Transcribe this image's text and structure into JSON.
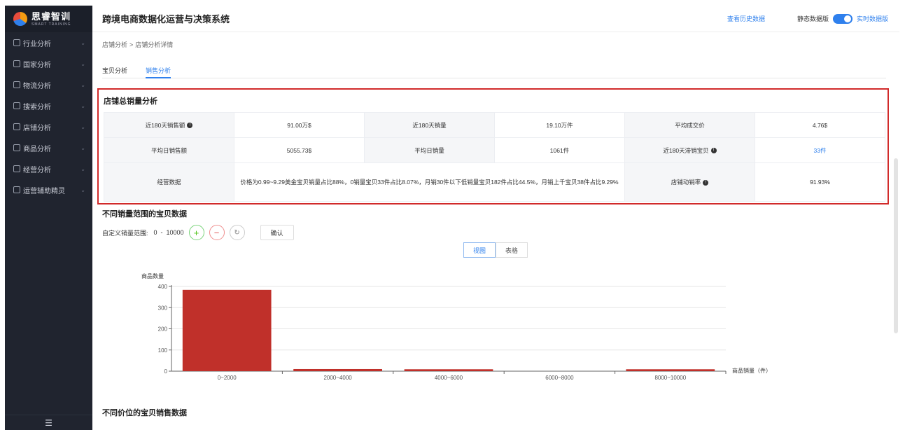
{
  "brand": {
    "name": "思睿智训",
    "sub": "SMART TRAINING"
  },
  "sidebar": {
    "items": [
      {
        "label": "行业分析"
      },
      {
        "label": "国家分析"
      },
      {
        "label": "物流分析"
      },
      {
        "label": "搜索分析"
      },
      {
        "label": "店铺分析"
      },
      {
        "label": "商品分析"
      },
      {
        "label": "经营分析"
      },
      {
        "label": "运营辅助精灵"
      }
    ],
    "chevron": "⌄",
    "footer_icon": "☰"
  },
  "header": {
    "title": "跨境电商数据化运营与决策系统",
    "history_link": "查看历史数据",
    "static_label": "静态数据版",
    "live_label": "实时数据版"
  },
  "breadcrumb": {
    "parent": "店铺分析",
    "separator": ">",
    "current": "店铺分析详情"
  },
  "tabs": [
    {
      "label": "宝贝分析"
    },
    {
      "label": "销售分析"
    }
  ],
  "summary": {
    "title": "店铺总销量分析",
    "rows": [
      [
        {
          "k": "近180天销售额",
          "v": "91.00万$"
        },
        {
          "k": "近180天销量",
          "v": "19.10万件"
        },
        {
          "k": "平均成交价",
          "v": "4.76$"
        }
      ],
      [
        {
          "k": "平均日销售额",
          "v": "5055.73$"
        },
        {
          "k": "平均日销量",
          "v": "1061件"
        },
        {
          "k": "近180天滞销宝贝",
          "v": "33件"
        }
      ]
    ],
    "ops_label": "经营数据",
    "ops_text": "价格为0.99~9.29美金宝贝销量占比88%，0销量宝贝33件占比8.07%，月销30件以下低销量宝贝182件占比44.5%，月销上千宝贝38件占比9.29%",
    "rate_label": "店铺动销率",
    "rate_value": "91.93%",
    "info_glyph": "!"
  },
  "range_section": {
    "title": "不同销量范围的宝贝数据",
    "label": "自定义销量范围:",
    "min": "0",
    "dash": "-",
    "max": "10000",
    "plus": "+",
    "minus": "−",
    "reset": "↻",
    "confirm": "确认",
    "view_chart": "视图",
    "view_table": "表格"
  },
  "chart_data": {
    "type": "bar",
    "ylabel": "商品数量",
    "xlabel": "商品销量（件）",
    "categories": [
      "0~2000",
      "2000~4000",
      "4000~6000",
      "6000~8000",
      "8000~10000"
    ],
    "values": [
      384,
      10,
      9,
      0,
      9
    ],
    "ylim": [
      0,
      400
    ],
    "yticks": [
      0,
      100,
      200,
      300,
      400
    ],
    "grid": true,
    "bar_color": "#c0302a"
  },
  "price_section": {
    "title": "不同价位的宝贝销售数据"
  }
}
